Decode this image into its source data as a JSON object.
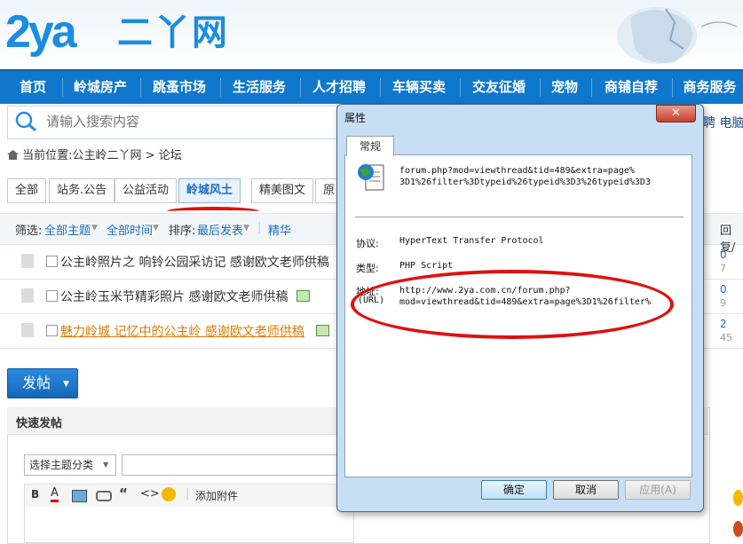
{
  "site": {
    "logo_latin": "2ya",
    "logo_cn": "二丫网"
  },
  "nav": [
    "首页",
    "岭城房产",
    "跳蚤市场",
    "生活服务",
    "人才招聘",
    "车辆买卖",
    "交友征婚",
    "宠物",
    "商铺自荐",
    "商务服务"
  ],
  "search": {
    "placeholder": "请输入搜索内容"
  },
  "breadcrumb": {
    "prefix": "当前位置:",
    "path": "公主岭二丫网 > 论坛"
  },
  "tabs": [
    "全部",
    "站务.公告",
    "公益活动",
    "岭城风土",
    "精美图文",
    "原"
  ],
  "active_tab": "岭城风土",
  "filter": {
    "label": "筛选:",
    "topic": "全部主题",
    "time": "全部时间",
    "sort_label": "排序:",
    "sort": "最后发表",
    "digest": "精华",
    "replies": "回复/"
  },
  "threads": [
    {
      "title": "公主岭照片之 响铃公园采访记 感谢欧文老师供稿",
      "replies": "0",
      "views": "7"
    },
    {
      "title": "公主岭玉米节精彩照片 感谢欧文老师供稿",
      "replies": "0",
      "views": "9"
    },
    {
      "title": "魅力岭城 记忆中的公主岭 感谢欧文老师供稿",
      "replies": "2",
      "views": "45"
    }
  ],
  "post_button": "发帖",
  "quick_post": {
    "title": "快速发帖",
    "type_select": "选择主题分类",
    "attach": "添加附件"
  },
  "right_edge": {
    "nav_tail": "聘 电脑"
  },
  "dialog": {
    "title": "属性",
    "tab": "常规",
    "file_name_line1": "forum.php?mod=viewthread&tid=489&extra=page%",
    "file_name_line2": "3D1%26filter%3Dtypeid%26typeid%3D3%26typeid%3D3",
    "protocol_label": "协议:",
    "protocol_value": "HyperText Transfer Protocol",
    "type_label": "类型:",
    "type_value": "PHP Script",
    "address_label": "地址:",
    "address_label2": "(URL)",
    "address_line1": "http://www.2ya.com.cn/forum.php?",
    "address_line2": "mod=viewthread&tid=489&extra=page%3D1%26filter%",
    "ok": "确定",
    "cancel": "取消",
    "apply": "应用(A)"
  },
  "colors": {
    "nav": "#0f78cc",
    "accent": "#1b8de0",
    "highlight": "#e01010"
  }
}
